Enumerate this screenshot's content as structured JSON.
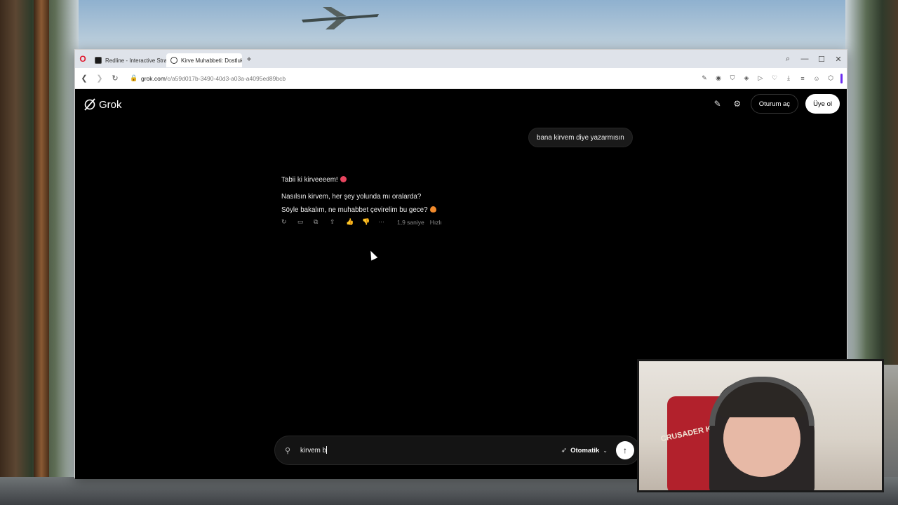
{
  "browser": {
    "tabs": [
      {
        "title": "Redline - Interactive Strate",
        "active": false
      },
      {
        "title": "Kirve Muhabbeti: Dostluk",
        "active": true
      }
    ],
    "new_tab": "+",
    "window_controls": {
      "search": "⌕",
      "minimize": "—",
      "maximize": "☐",
      "close": "✕"
    },
    "address": {
      "domain": "grok.com",
      "path": "/c/a59d017b-3490-40d3-a03a-a4095ed89bcb"
    }
  },
  "grok": {
    "logo_text": "Grok",
    "signin_label": "Oturum aç",
    "signup_label": "Üye ol",
    "conversation": {
      "user_message": "bana kirvem diye yazarmısın",
      "assistant_lines": [
        "Tabii ki kirveeeem!",
        "Nasılsın kirvem, her şey yolunda mı oralarda?",
        "Söyle bakalım, ne muhabbet çevirelim bu gece?"
      ],
      "response_time": "1,9 saniye",
      "mode_tag": "Hızlı"
    },
    "composer": {
      "value": "kirvem b",
      "mode_label": "Otomatik"
    }
  },
  "webcam": {
    "banner_text": "CRUSADER KINGS"
  },
  "colors": {
    "accent_purple": "#6b2cf0",
    "opera_red": "#e0182d",
    "page_bg": "#000000"
  }
}
